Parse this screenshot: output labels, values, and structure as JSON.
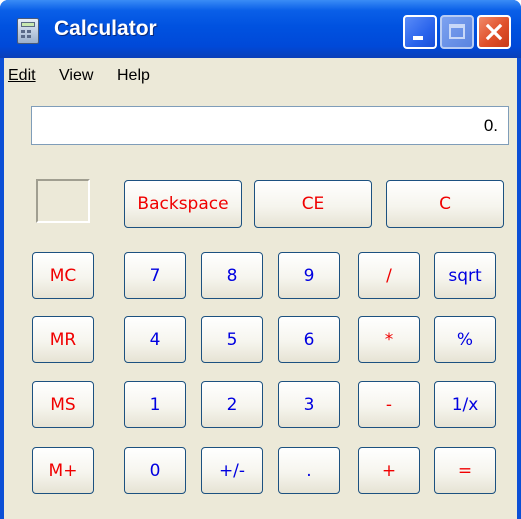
{
  "window": {
    "title": "Calculator"
  },
  "menu": {
    "items": [
      "Edit",
      "View",
      "Help"
    ]
  },
  "display": {
    "value": "0."
  },
  "keys": {
    "backspace": "Backspace",
    "ce": "CE",
    "c": "C",
    "mc": "MC",
    "mr": "MR",
    "ms": "MS",
    "mplus": "M+",
    "d7": "7",
    "d8": "8",
    "d9": "9",
    "div": "/",
    "sqrt": "sqrt",
    "d4": "4",
    "d5": "5",
    "d6": "6",
    "mul": "*",
    "pct": "%",
    "d1": "1",
    "d2": "2",
    "d3": "3",
    "sub": "-",
    "recip": "1/x",
    "d0": "0",
    "sign": "+/-",
    "dot": ".",
    "add": "+",
    "eq": "="
  },
  "colors": {
    "titlebar": "#0052e0",
    "client_bg": "#ece9d8",
    "key_red": "#f00000",
    "key_blue": "#0000e0",
    "key_border": "#1c5180"
  },
  "icons": {
    "app": "calculator-icon",
    "minimize": "minimize-icon",
    "maximize": "maximize-icon",
    "close": "close-icon"
  }
}
